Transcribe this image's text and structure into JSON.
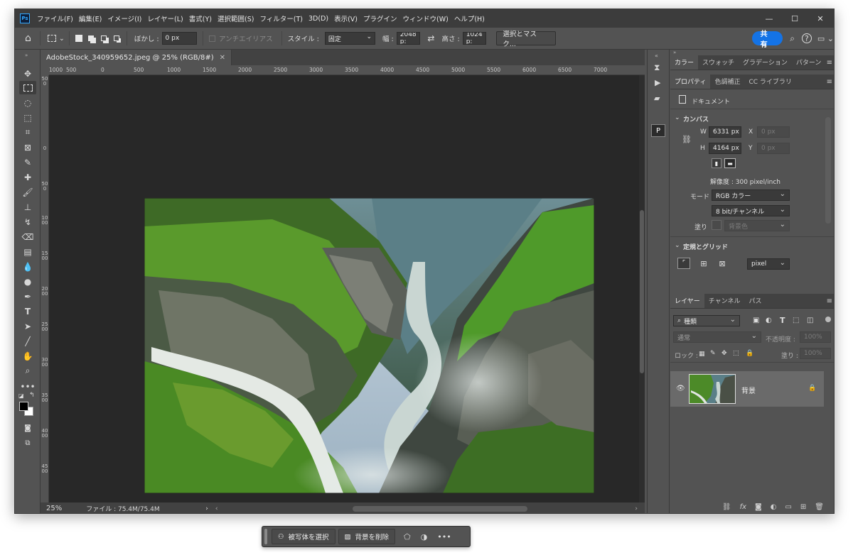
{
  "app": {
    "logo": "Ps"
  },
  "menu": [
    "ファイル(F)",
    "編集(E)",
    "イメージ(I)",
    "レイヤー(L)",
    "書式(Y)",
    "選択範囲(S)",
    "フィルター(T)",
    "3D(D)",
    "表示(V)",
    "プラグイン",
    "ウィンドウ(W)",
    "ヘルプ(H)"
  ],
  "options": {
    "feather_label": "ぼかし :",
    "feather_value": "0 px",
    "antialias_label": "アンチエイリアス",
    "style_label": "スタイル :",
    "style_value": "固定",
    "width_label": "幅 :",
    "width_value": "2048 p:",
    "height_label": "高さ :",
    "height_value": "1024 p:",
    "select_mask_button": "選択とマスク...",
    "share_button": "共有"
  },
  "document_tab": {
    "title": "AdobeStock_340959652.jpeg @ 25% (RGB/8#)"
  },
  "ruler": {
    "h_ticks": [
      "1000",
      "500",
      "0",
      "500",
      "1000",
      "1500",
      "2000",
      "2500",
      "3000",
      "3500",
      "4000",
      "4500",
      "5000",
      "5500",
      "6000",
      "6500",
      "7000"
    ],
    "v_ticks": [
      "500",
      "0",
      "500",
      "1000",
      "1500",
      "2000",
      "2500",
      "3000",
      "3500",
      "4000",
      "4500"
    ]
  },
  "status": {
    "zoom": "25%",
    "file_info": "ファイル : 75.4M/75.4M"
  },
  "color_panel": {
    "tabs": [
      "カラー",
      "スウォッチ",
      "グラデーション",
      "パターン"
    ],
    "active": 0
  },
  "properties_panel": {
    "tabs": [
      "プロパティ",
      "色調補正",
      "CC ライブラリ"
    ],
    "active": 0,
    "doc_label": "ドキュメント",
    "canvas_section": "カンバス",
    "w_label": "W",
    "w_value": "6331 px",
    "h_label": "H",
    "h_value": "4164 px",
    "x_label": "X",
    "x_placeholder": "0 px",
    "y_label": "Y",
    "y_placeholder": "0 px",
    "resolution": "解像度 : 300 pixel/inch",
    "mode_label": "モード",
    "mode_value": "RGB カラー",
    "bit_value": "8 bit/チャンネル",
    "fill_label": "塗り",
    "fill_value": "背景色",
    "grid_section": "定規とグリッド",
    "unit_value": "pixel"
  },
  "layers_panel": {
    "tabs": [
      "レイヤー",
      "チャンネル",
      "パス"
    ],
    "active": 0,
    "kind_label": "種類",
    "blend_mode": "通常",
    "opacity_label": "不透明度 :",
    "opacity_value": "100%",
    "lock_label": "ロック :",
    "fill_label": "塗り :",
    "fill_value": "100%",
    "layers": [
      {
        "name": "背景",
        "visible": true,
        "locked": true
      }
    ]
  },
  "contextual_bar": {
    "select_subject": "被写体を選択",
    "remove_background": "背景を削除"
  },
  "colors": {
    "accent": "#1473e6",
    "panel": "#535353",
    "canvas": "#282828"
  }
}
